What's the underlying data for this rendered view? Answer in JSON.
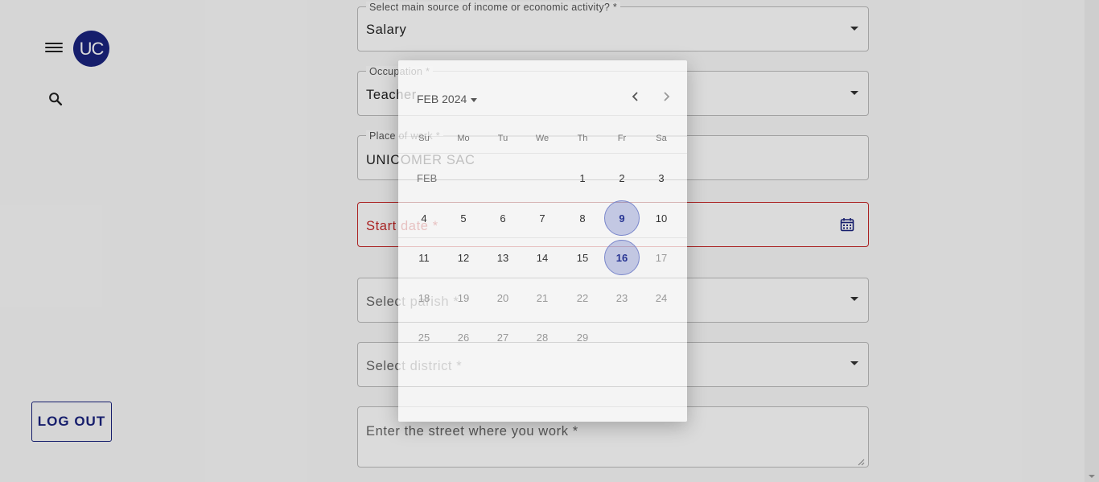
{
  "sidebar": {
    "avatar_initials": "UC",
    "logout_label": "LOG OUT"
  },
  "form": {
    "income_label": "Select main source of income or economic activity? *",
    "income_value": "Salary",
    "occupation_label": "Occupation *",
    "occupation_value": "Teacher",
    "workplace_label": "Place of work *",
    "workplace_value": "UNICOMER SAC",
    "start_date_placeholder": "Start date *",
    "parish_placeholder": "Select parish *",
    "district_placeholder": "Select district *",
    "street_placeholder": "Enter the street where you work *"
  },
  "datepicker": {
    "month_label": "FEB 2024",
    "month_tag": "FEB",
    "weekdays": [
      "Su",
      "Mo",
      "Tu",
      "We",
      "Th",
      "Fr",
      "Sa"
    ],
    "weeks": [
      [
        "",
        "",
        "",
        "",
        "1",
        "2",
        "3"
      ],
      [
        "4",
        "5",
        "6",
        "7",
        "8",
        "9",
        "10"
      ],
      [
        "11",
        "12",
        "13",
        "14",
        "15",
        "16",
        "17"
      ],
      [
        "18",
        "19",
        "20",
        "21",
        "22",
        "23",
        "24"
      ],
      [
        "25",
        "26",
        "27",
        "28",
        "29",
        "",
        ""
      ]
    ],
    "selected_days": [
      "9",
      "16"
    ]
  },
  "colors": {
    "brand": "#1a237e",
    "error": "#c62828",
    "selected_day": "#7986cb"
  }
}
